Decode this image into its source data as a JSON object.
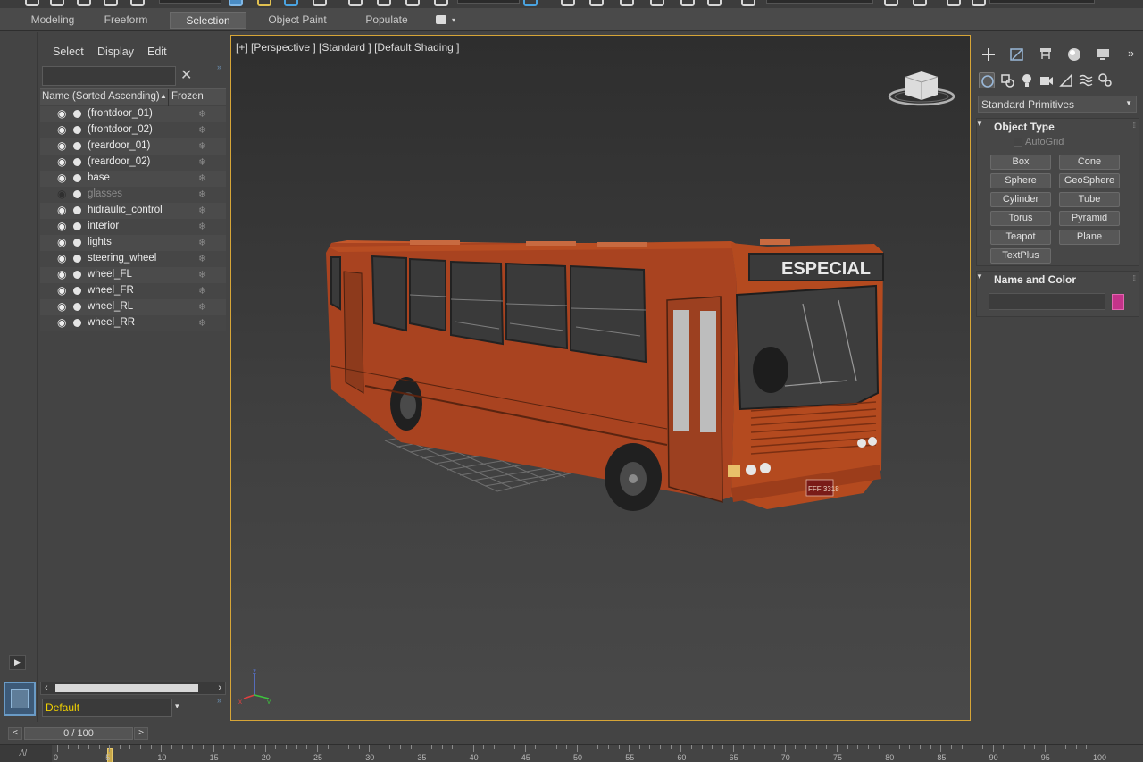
{
  "ribbon": {
    "tabs": [
      {
        "label": "Modeling",
        "active": false
      },
      {
        "label": "Freeform",
        "active": false
      },
      {
        "label": "Selection",
        "active": true
      },
      {
        "label": "Object Paint",
        "active": false
      },
      {
        "label": "Populate",
        "active": false
      }
    ]
  },
  "scene_explorer": {
    "menu": [
      "Select",
      "Display",
      "Edit"
    ],
    "search_value": "",
    "columns": {
      "name": "Name (Sorted Ascending)",
      "frozen": "Frozen"
    },
    "objects": [
      {
        "name": "(frontdoor_01)",
        "visible": true
      },
      {
        "name": "(frontdoor_02)",
        "visible": true
      },
      {
        "name": "(reardoor_01)",
        "visible": true
      },
      {
        "name": "(reardoor_02)",
        "visible": true
      },
      {
        "name": "base",
        "visible": true
      },
      {
        "name": "glasses",
        "visible": false
      },
      {
        "name": "hidraulic_control",
        "visible": true
      },
      {
        "name": "interior",
        "visible": true
      },
      {
        "name": "lights",
        "visible": true
      },
      {
        "name": "steering_wheel",
        "visible": true
      },
      {
        "name": "wheel_FL",
        "visible": true
      },
      {
        "name": "wheel_FR",
        "visible": true
      },
      {
        "name": "wheel_RL",
        "visible": true
      },
      {
        "name": "wheel_RR",
        "visible": true
      }
    ],
    "layer": "Default"
  },
  "viewport": {
    "label": "[+] [Perspective ] [Standard ] [Default Shading ]",
    "bus_sign": "ESPECIAL",
    "plate": "FFF 3318",
    "border_color": "#d6a537",
    "body_color": "#b5481e"
  },
  "command_panel": {
    "dropdown": "Standard Primitives",
    "object_type_title": "Object Type",
    "autogrid_label": "AutoGrid",
    "primitives": [
      "Box",
      "Cone",
      "Sphere",
      "GeoSphere",
      "Cylinder",
      "Tube",
      "Torus",
      "Pyramid",
      "Teapot",
      "Plane",
      "TextPlus"
    ],
    "name_color_title": "Name and Color",
    "name_value": "",
    "object_color": "#c4338a"
  },
  "timeline": {
    "frame_display": "0 / 100",
    "prev": "<",
    "next": ">",
    "ruler_labels": [
      "0",
      "5",
      "10",
      "15",
      "20",
      "25",
      "30",
      "35",
      "40",
      "45",
      "50",
      "55",
      "60",
      "65",
      "70",
      "75",
      "80",
      "85",
      "90",
      "95",
      "100"
    ]
  }
}
